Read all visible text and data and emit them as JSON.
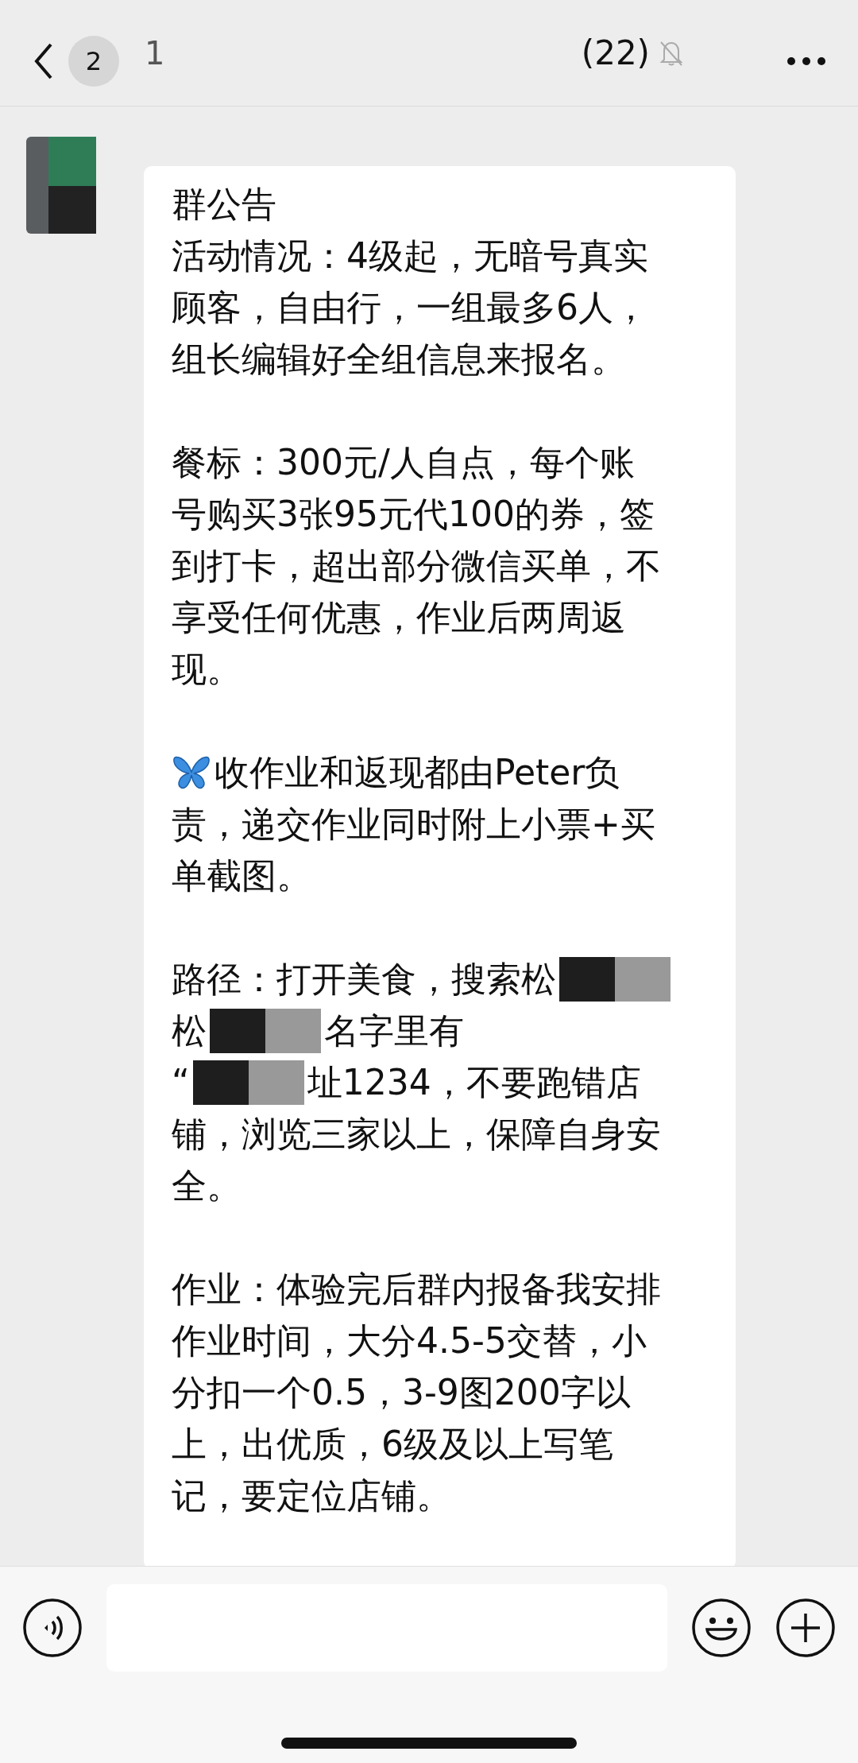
{
  "header": {
    "unread": "2",
    "title": "1",
    "member_count": "(22)",
    "muted": true
  },
  "message": {
    "paragraphs": [
      {
        "lines": [
          [
            {
              "kind": "text",
              "text": "群公告"
            }
          ],
          [
            {
              "kind": "text",
              "text": "活动情况：4级起，无暗号真实"
            }
          ],
          [
            {
              "kind": "text",
              "text": "顾客，自由行，一组最多6人，"
            }
          ],
          [
            {
              "kind": "text",
              "text": "组长编辑好全组信息来报名。"
            }
          ]
        ]
      },
      {
        "lines": [
          [
            {
              "kind": "text",
              "text": "餐标：300元/人自点，每个账"
            }
          ],
          [
            {
              "kind": "text",
              "text": "号购买3张95元代100的券，签"
            }
          ],
          [
            {
              "kind": "text",
              "text": "到打卡，超出部分微信买单，不"
            }
          ],
          [
            {
              "kind": "text",
              "text": "享受任何优惠，作业后两周返"
            }
          ],
          [
            {
              "kind": "text",
              "text": "现。"
            }
          ]
        ]
      },
      {
        "lines": [
          [
            {
              "kind": "butterfly"
            },
            {
              "kind": "text",
              "text": "收作业和返现都由Peter负"
            }
          ],
          [
            {
              "kind": "text",
              "text": "责，递交作业同时附上小票+买"
            }
          ],
          [
            {
              "kind": "text",
              "text": "单截图。"
            }
          ]
        ]
      },
      {
        "lines": [
          [
            {
              "kind": "text",
              "text": "路径：打开美食，搜索松"
            },
            {
              "kind": "redaction"
            }
          ],
          [
            {
              "kind": "text",
              "text": "松"
            },
            {
              "kind": "redaction"
            },
            {
              "kind": "text",
              "text": "名字里有"
            }
          ],
          [
            {
              "kind": "text",
              "text": "“"
            },
            {
              "kind": "redaction"
            },
            {
              "kind": "text",
              "text": "址1234，不要跑错店"
            }
          ],
          [
            {
              "kind": "text",
              "text": "铺，浏览三家以上，保障自身安"
            }
          ],
          [
            {
              "kind": "text",
              "text": "全。"
            }
          ]
        ]
      },
      {
        "lines": [
          [
            {
              "kind": "text",
              "text": "作业：体验完后群内报备我安排"
            }
          ],
          [
            {
              "kind": "text",
              "text": "作业时间，大分4.5-5交替，小"
            }
          ],
          [
            {
              "kind": "text",
              "text": "分扣一个0.5，3-9图200字以"
            }
          ],
          [
            {
              "kind": "text",
              "text": "上，出优质，6级及以上写笔"
            }
          ],
          [
            {
              "kind": "text",
              "text": "记，要定位店铺。"
            }
          ]
        ]
      }
    ]
  }
}
